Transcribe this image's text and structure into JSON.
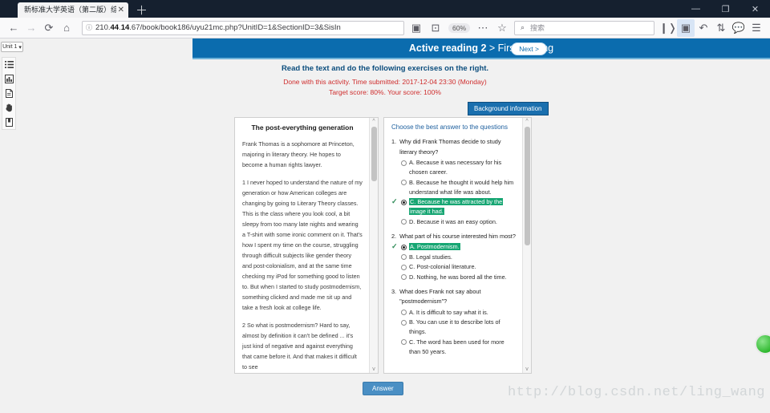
{
  "browser": {
    "tab_title": "新标准大学英语（第二版）综合教",
    "tab_close": "✕",
    "new_tab": "＋",
    "minimize": "—",
    "maximize": "❐",
    "close": "✕",
    "back": "←",
    "forward": "→",
    "reload": "⟳",
    "home": "⌂",
    "url_prefix": "210.",
    "url_bold1": "44",
    "url_mid": ".",
    "url_bold2": "14",
    "url_suffix": ".67/book/book186/uyu21mc.php?UnitID=1&SectionID=3&SisIn",
    "url_full": "210.44.14.67/book/book186/uyu21mc.php?UnitID=1&SectionID=3&SisIn",
    "identity_icon": "ⓘ",
    "reader_icon": "▣",
    "pocket_icon": "⊡",
    "zoom_level": "60%",
    "overflow_icon": "⋯",
    "bookmark_icon": "☆",
    "search_icon": "⌕",
    "search_placeholder": "搜索",
    "library_icon": "❙❭",
    "sidebar_icon": "▣",
    "undo_icon": "↶",
    "sync_icon": "⇅",
    "chat_icon": "💬",
    "menu_icon": "☰"
  },
  "rail": {
    "unit_label": "Unit 1",
    "unit_caret": "▾",
    "icons": [
      {
        "name": "list-icon",
        "glyph": "☰"
      },
      {
        "name": "chart-icon",
        "glyph": "▤"
      },
      {
        "name": "document-icon",
        "glyph": "🗎"
      },
      {
        "name": "hand-icon",
        "glyph": "✋"
      },
      {
        "name": "book-icon",
        "glyph": "📖"
      }
    ]
  },
  "banner": {
    "title_bold": "Active reading 2",
    "title_rest": " > First reading",
    "next_label": "Next >"
  },
  "instruction": "Read the text and do the following exercises on the right.",
  "status": {
    "line1": "Done with this activity. Time submitted: 2017-12-04 23:30 (Monday)",
    "line2": "Target score: 80%.  Your score: 100%"
  },
  "background_button": "Background information",
  "reading": {
    "title": "The post-everything generation",
    "paragraphs": [
      "Frank Thomas is a sophomore at Princeton, majoring in literary theory. He hopes to become a human rights lawyer.",
      "1 I never hoped to understand the nature of my generation or how American colleges are changing by going to Literary Theory classes. This is the class where you look cool, a bit sleepy from too many late nights and wearing a T-shirt with some ironic comment on it. That's how I spent my time on the course, struggling through difficult subjects like gender theory and post-colonialism, and at the same time checking my iPod for something good to listen to. But when I started to study postmodernism, something clicked and made me sit up and take a fresh look at college life.",
      "2 So what is postmodernism? Hard to say, almost by definition it can't be defined ... it's just kind of negative and against everything that came before it. And that makes it difficult to see"
    ]
  },
  "questions_header": "Choose the best answer to the questions",
  "questions": [
    {
      "num": "1.",
      "text": "Why did Frank Thomas decide to study literary theory?",
      "options": [
        {
          "label": "A. Because it was necessary for his chosen career.",
          "selected": false,
          "correct": false
        },
        {
          "label": "B. Because he thought it would help him understand what life was about.",
          "selected": false,
          "correct": false
        },
        {
          "label": "C. Because he was attracted by the image it had.",
          "selected": true,
          "correct": true
        },
        {
          "label": "D. Because it was an easy option.",
          "selected": false,
          "correct": false
        }
      ]
    },
    {
      "num": "2.",
      "text": "What part of his course interested him most?",
      "options": [
        {
          "label": "A. Postmodernism.",
          "selected": true,
          "correct": true
        },
        {
          "label": "B. Legal studies.",
          "selected": false,
          "correct": false
        },
        {
          "label": "C. Post-colonial literature.",
          "selected": false,
          "correct": false
        },
        {
          "label": "D. Nothing, he was bored all the time.",
          "selected": false,
          "correct": false
        }
      ]
    },
    {
      "num": "3.",
      "text": "What does Frank not say about \"postmodernism\"?",
      "options": [
        {
          "label": "A. It is difficult to say what it is.",
          "selected": false,
          "correct": false
        },
        {
          "label": "B. You can use it to describe lots of things.",
          "selected": false,
          "correct": false
        },
        {
          "label": "C. The word has been used for more than 50 years.",
          "selected": false,
          "correct": false
        }
      ]
    }
  ],
  "answer_button": "Answer",
  "watermark": "http://blog.csdn.net/ling_wang",
  "scroll": {
    "up_arrow": "^",
    "down_arrow": "v"
  },
  "colors": {
    "banner_blue": "#0b6cae",
    "status_red": "#cf2d2d",
    "highlight_green": "#17a673",
    "tick_green": "#2e8b57",
    "answer_blue": "#4a8fc4"
  }
}
